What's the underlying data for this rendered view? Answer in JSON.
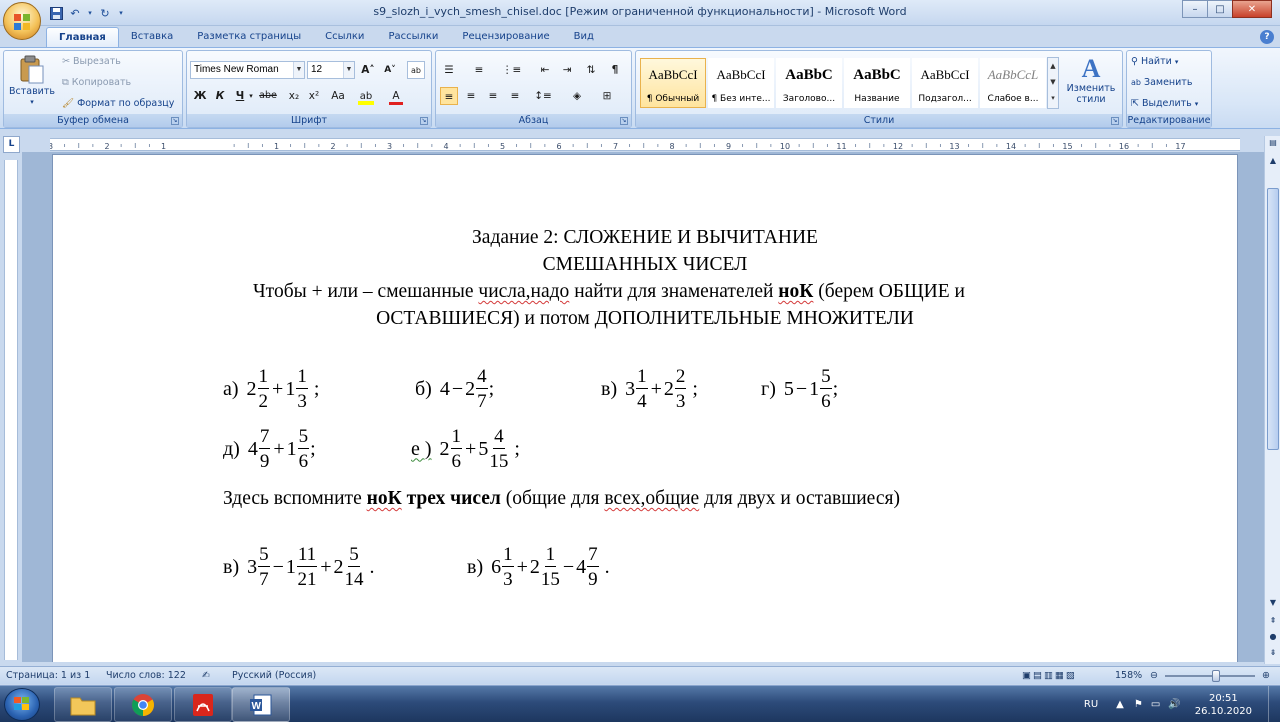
{
  "window": {
    "title": "s9_slozh_i_vych_smesh_chisel.doc [Режим ограниченной функциональности] - Microsoft Word",
    "minimize": "–",
    "maximize": "□",
    "close": "✕"
  },
  "qat": {
    "save_icon": "save-icon",
    "undo_icon": "undo-icon",
    "redo_icon": "redo-icon"
  },
  "tabs": [
    "Главная",
    "Вставка",
    "Разметка страницы",
    "Ссылки",
    "Рассылки",
    "Рецензирование",
    "Вид"
  ],
  "clipboard": {
    "paste": "Вставить",
    "cut": "Вырезать",
    "copy": "Копировать",
    "format_painter": "Формат по образцу",
    "label": "Буфер обмена"
  },
  "font": {
    "family": "Times New Roman",
    "size": "12",
    "label": "Шрифт",
    "bold": "Ж",
    "italic": "К",
    "underline": "Ч",
    "strike": "abe",
    "subscript": "x₂",
    "superscript": "x²",
    "case": "Aa",
    "grow": "A˄",
    "shrink": "A˅"
  },
  "paragraph": {
    "label": "Абзац"
  },
  "styles": {
    "label": "Стили",
    "items": [
      {
        "sample": "AaBbCcI",
        "name": "¶ Обычный",
        "selected": true
      },
      {
        "sample": "AaBbCcI",
        "name": "¶ Без инте..."
      },
      {
        "sample": "AaBbC",
        "name": "Заголово..."
      },
      {
        "sample": "AaBbC",
        "name": "Название"
      },
      {
        "sample": "AaBbCcI",
        "name": "Подзагол..."
      },
      {
        "sample": "AaBbCcL",
        "name": "Слабое в..."
      }
    ],
    "change_line1": "Изменить",
    "change_line2": "стили"
  },
  "editing": {
    "label": "Редактирование",
    "find": "Найти",
    "replace": "Заменить",
    "select": "Выделить"
  },
  "ruler": {
    "marks": [
      "3",
      "2",
      "1",
      "1",
      "2",
      "3",
      "4",
      "5",
      "6",
      "7",
      "8",
      "9",
      "10",
      "11",
      "12",
      "13",
      "14",
      "15",
      "16",
      "17"
    ]
  },
  "document": {
    "heading1": "Задание 2: СЛОЖЕНИЕ И ВЫЧИТАНИЕ",
    "heading2": "СМЕШАННЫХ ЧИСЕЛ",
    "rule_line1_pre": "Чтобы + или – смешанные ",
    "rule_line1_squig": "числа,надо",
    "rule_line1_mid": " найти для знаменателей ",
    "rule_line1_bold": "ноК",
    "rule_line1_post": " (берем ОБЩИЕ и",
    "rule_line2": "ОСТАВШИЕСЯ) и потом ДОПОЛНИТЕЛЬНЫЕ  МНОЖИТЕЛИ",
    "hint_pre": "Здесь вспомните ",
    "hint_bold1": "ноК",
    "hint_bold2": " трех  чисел",
    "hint_post1": " (общие  для ",
    "hint_squig": "всех,общие",
    "hint_post2": "  для двух и оставшиеся)"
  },
  "status": {
    "page": "Страница: 1 из 1",
    "words": "Число слов: 122",
    "lang": "Русский (Россия)",
    "zoom": "158%",
    "zoom_level": 0.58
  },
  "taskbar": {
    "apps": [
      "explorer-icon",
      "chrome-icon",
      "acrobat-icon",
      "word-icon"
    ],
    "lang": "RU",
    "time": "20:51",
    "date": "26.10.2020"
  }
}
